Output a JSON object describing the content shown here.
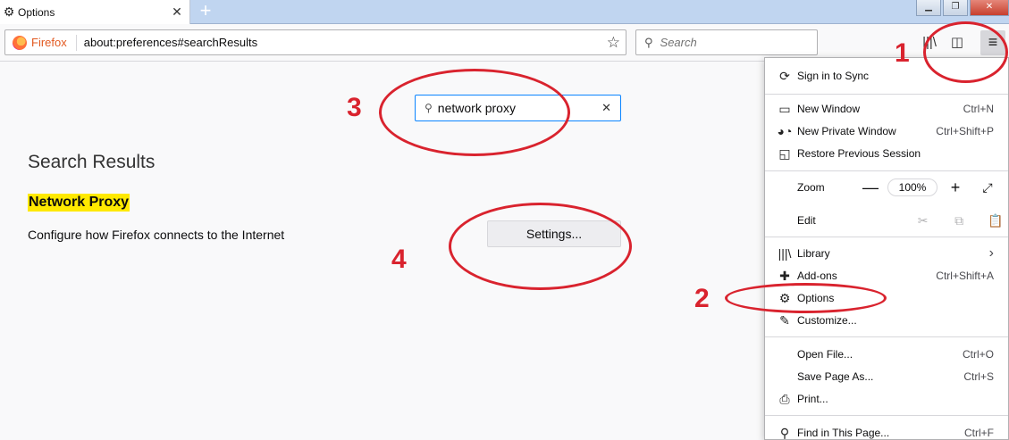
{
  "tab": {
    "title": "Options",
    "icon": "⚙",
    "close": "✕"
  },
  "newtab": "+",
  "window": {
    "minimize": "▁",
    "restore": "❐",
    "close": "✕"
  },
  "urlbar": {
    "brand": "Firefox",
    "url": "about:preferences#searchResults",
    "star": "☆"
  },
  "searchbar": {
    "placeholder": "Search",
    "icon": "⚲"
  },
  "toolbar": {
    "library": "|||\\",
    "sidebar": "◫",
    "menu": "≡"
  },
  "prefs": {
    "search_value": "network proxy",
    "search_icon": "⚲",
    "search_clear": "✕",
    "results_title": "Search Results",
    "section_title": "Network Proxy",
    "section_desc": "Configure how Firefox connects to the Internet",
    "settings_button": "Settings..."
  },
  "annotations": [
    "1",
    "2",
    "3",
    "4"
  ],
  "annotation_color": "#d9232e",
  "menu": {
    "sign_in": "Sign in to Sync",
    "new_window": "New Window",
    "new_window_key": "Ctrl+N",
    "new_private": "New Private Window",
    "new_private_key": "Ctrl+Shift+P",
    "restore": "Restore Previous Session",
    "zoom": "Zoom",
    "zoom_minus": "—",
    "zoom_value": "100%",
    "zoom_plus": "+",
    "zoom_full": "⤢",
    "edit": "Edit",
    "cut": "✂",
    "copy": "⧉",
    "paste": "📋",
    "library": "Library",
    "library_arrow": "›",
    "addons": "Add-ons",
    "addons_key": "Ctrl+Shift+A",
    "options": "Options",
    "customize": "Customize...",
    "open_file": "Open File...",
    "open_file_key": "Ctrl+O",
    "save_page": "Save Page As...",
    "save_page_key": "Ctrl+S",
    "print": "Print...",
    "find": "Find in This Page...",
    "find_key": "Ctrl+F"
  }
}
